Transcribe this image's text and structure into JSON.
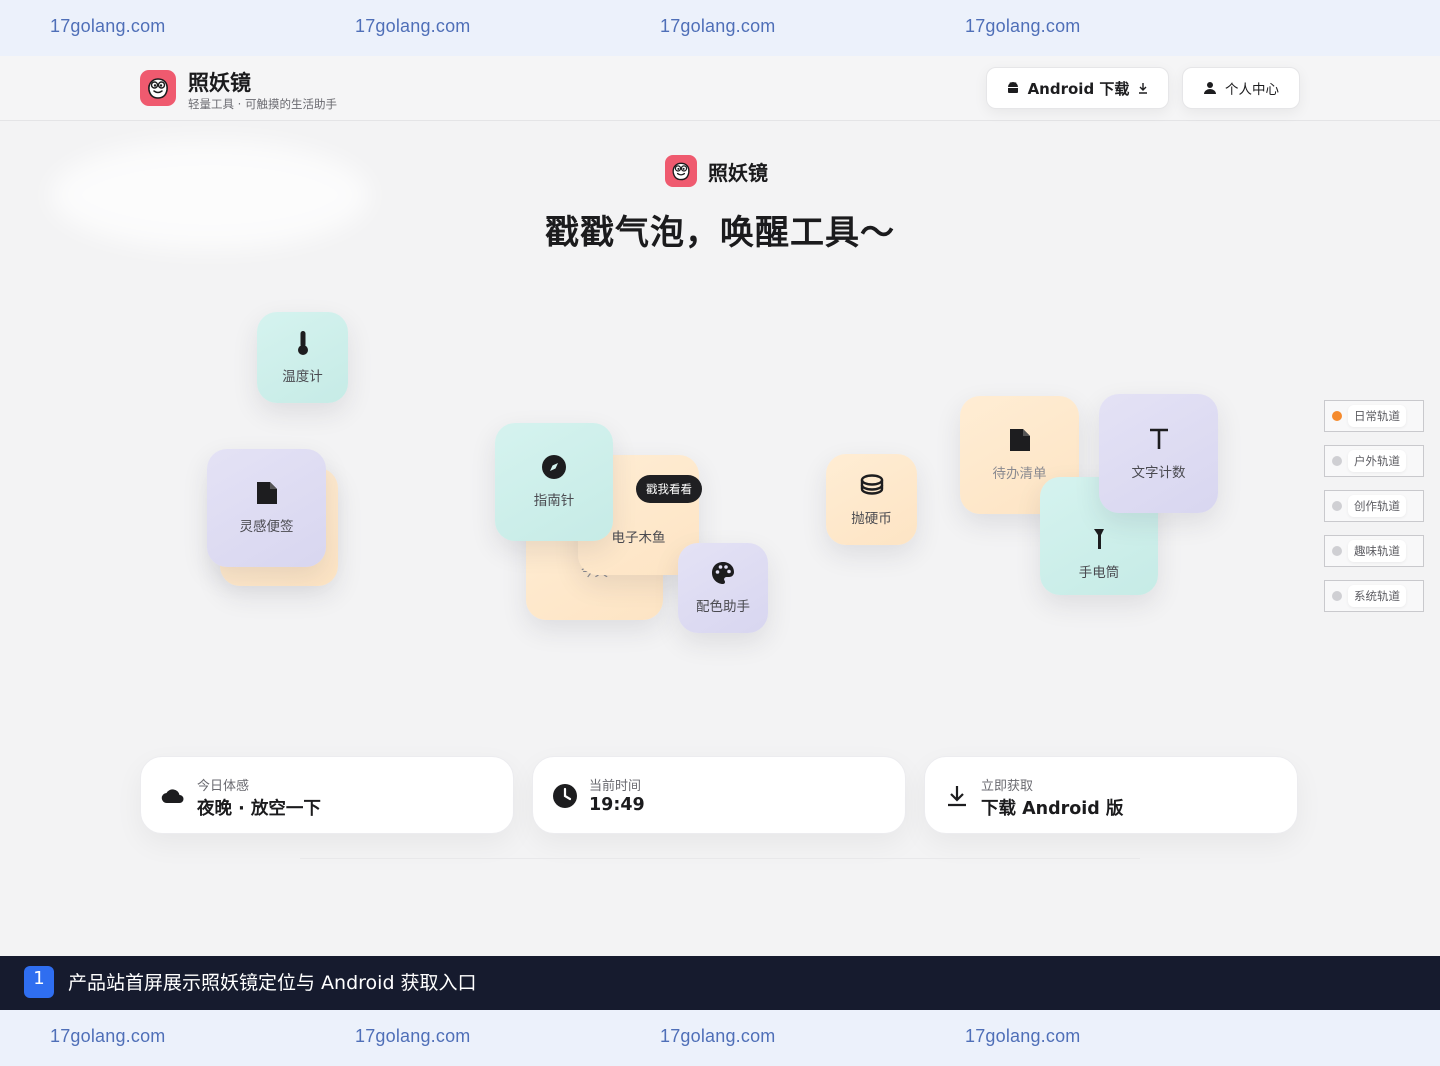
{
  "watermark": {
    "text": "17golang.com"
  },
  "header": {
    "brand": "照妖镜",
    "tagline": "轻量工具 · 可触摸的生活助手",
    "android_button": "Android 下载",
    "profile_button": "个人中心"
  },
  "hero": {
    "brand": "照妖镜",
    "title": "戳戳气泡，唤醒工具～"
  },
  "bubbles": {
    "thermometer": "温度计",
    "notes": "灵感便签",
    "compass": "指南针",
    "woodfish": "电子木鱼",
    "today": "今天",
    "tooltip": "戳我看看",
    "palette": "配色助手",
    "coin": "抛硬币",
    "todo": "待办清单",
    "wordcount": "文字计数",
    "flashlight": "手电筒"
  },
  "tracks": [
    {
      "label": "日常轨道",
      "active": true
    },
    {
      "label": "户外轨道",
      "active": false
    },
    {
      "label": "创作轨道",
      "active": false
    },
    {
      "label": "趣味轨道",
      "active": false
    },
    {
      "label": "系统轨道",
      "active": false
    }
  ],
  "info_cards": {
    "mood": {
      "label": "今日体感",
      "value": "夜晚 · 放空一下",
      "icon": "cloud-icon"
    },
    "time": {
      "label": "当前时间",
      "value": "19:49",
      "icon": "clock-icon"
    },
    "download": {
      "label": "立即获取",
      "value": "下载 Android 版",
      "icon": "download-icon"
    }
  },
  "caption": {
    "number": "1",
    "text": "产品站首屏展示照妖镜定位与 Android 获取入口"
  },
  "colors": {
    "brand": "#ef5a6f",
    "accent_active": "#f58a2c",
    "caption_bg": "#161b2e",
    "caption_badge": "#2f6ef0",
    "watermark": "#4f6fb8"
  }
}
